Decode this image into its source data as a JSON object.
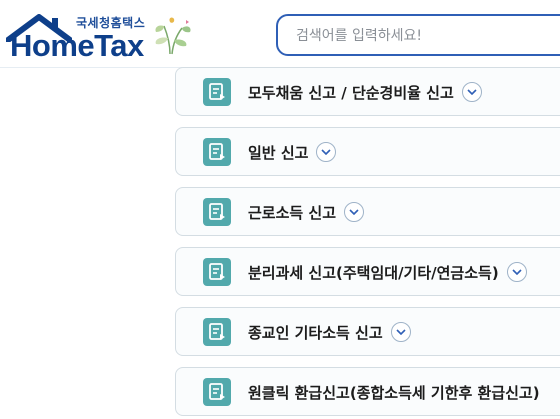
{
  "header": {
    "logo_small": "국세청홈택스",
    "logo_big": "HomeTax",
    "search_placeholder": "검색어를 입력하세요!"
  },
  "items": [
    {
      "label": "모두채움 신고 / 단순경비율 신고"
    },
    {
      "label": "일반 신고"
    },
    {
      "label": "근로소득 신고"
    },
    {
      "label": "분리과세 신고(주택임대/기타/연금소득)"
    },
    {
      "label": "종교인 기타소득 신고"
    },
    {
      "label": "원클릭 환급신고(종합소득세 기한후 환급신고)"
    }
  ],
  "colors": {
    "brand": "#0e3f8a",
    "search_border": "#2f5fb6",
    "item_icon": "#52a9ac"
  }
}
